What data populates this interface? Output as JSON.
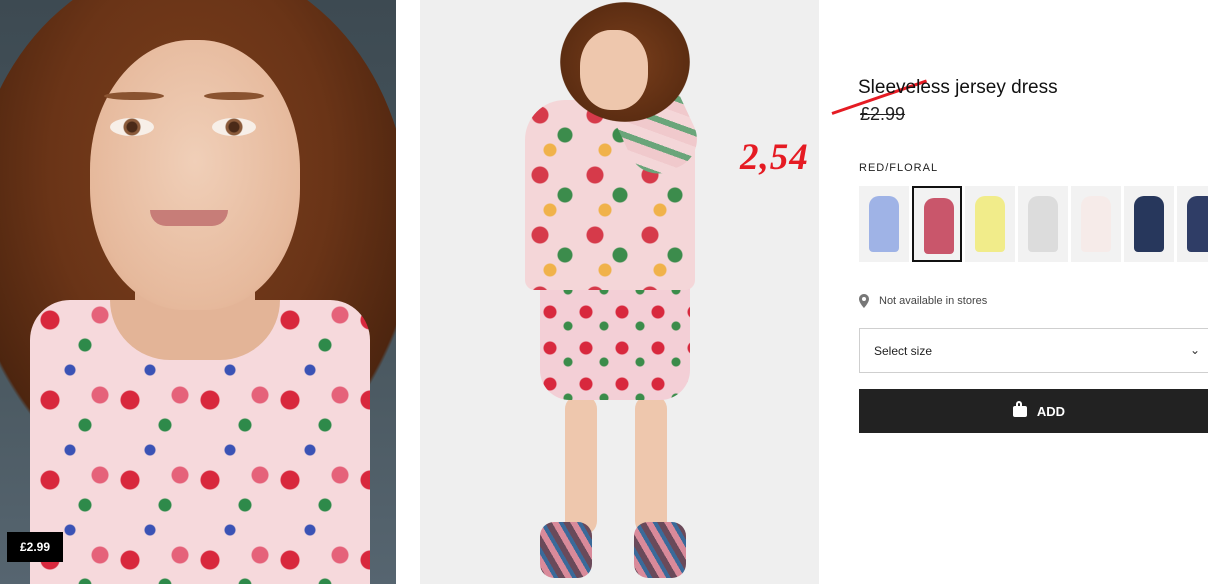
{
  "product": {
    "title": "Sleeveless jersey dress",
    "price": "£2.99",
    "color_label": "RED/FLORAL",
    "badge_price": "£2.99"
  },
  "annotation": {
    "new_price": "2,54",
    "color": "#e51b23"
  },
  "swatches": [
    {
      "name": "blue-floral",
      "color": "#9fb3e6"
    },
    {
      "name": "red-floral",
      "color": "#c9566b",
      "selected": true
    },
    {
      "name": "yellow-print",
      "color": "#f1ec8a"
    },
    {
      "name": "white-grey",
      "color": "#dcdcdc"
    },
    {
      "name": "white-dots",
      "color": "#f6ebe9"
    },
    {
      "name": "navy-floral",
      "color": "#27375c"
    },
    {
      "name": "navy-print",
      "color": "#2f3d66"
    }
  ],
  "store": {
    "availability": "Not available in stores"
  },
  "size_select": {
    "label": "Select size"
  },
  "add_button": {
    "label": "ADD"
  }
}
